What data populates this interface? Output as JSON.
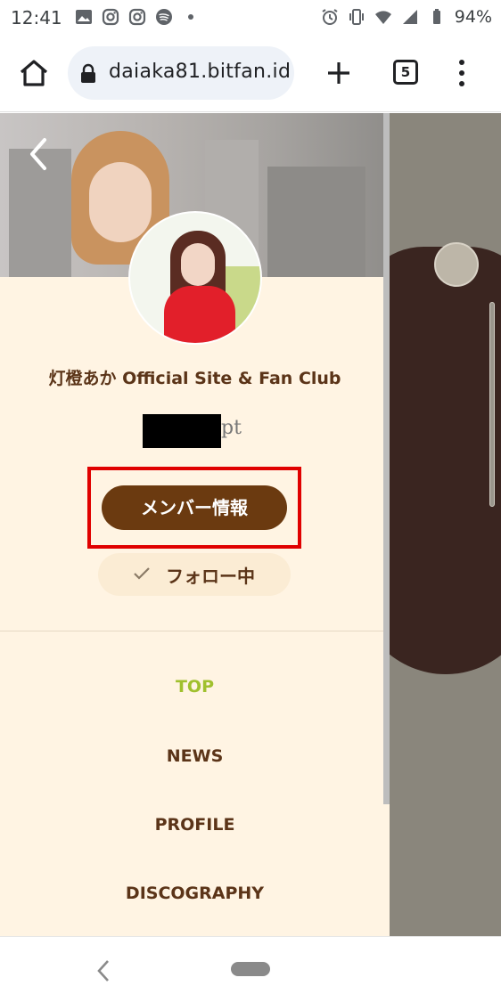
{
  "status_bar": {
    "time": "12:41",
    "battery": "94%"
  },
  "browser": {
    "url": "daiaka81.bitfan.id",
    "tab_count": "5"
  },
  "drawer": {
    "site_title": "灯橙あか Official Site & Fan Club",
    "points_unit": "pt",
    "member_button": "メンバー情報",
    "follow_button": "フォロー中",
    "nav_items": [
      "TOP",
      "NEWS",
      "PROFILE",
      "DISCOGRAPHY"
    ],
    "active_nav": "TOP"
  },
  "colors": {
    "drawer_bg": "#fff4e3",
    "primary_brown": "#6b3a10",
    "text_brown": "#5b3418",
    "active_green": "#a0c02e",
    "highlight_red": "#e00000"
  }
}
